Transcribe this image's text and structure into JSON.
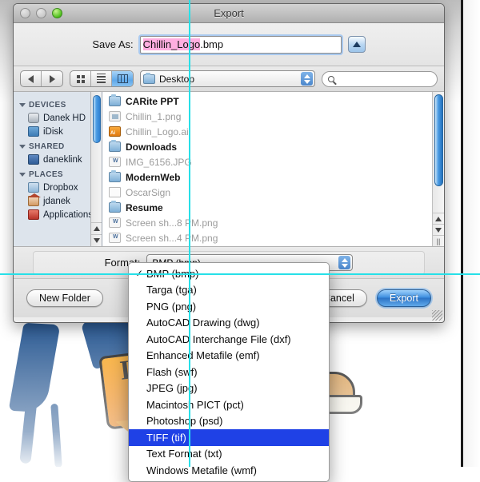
{
  "window": {
    "title": "Export",
    "traffic_lights": [
      "close",
      "minimize",
      "zoom"
    ]
  },
  "save_as": {
    "label": "Save As:",
    "selected_text": "Chillin_Logo",
    "remainder_text": ".bmp",
    "full_value": "Chillin_Logo.bmp",
    "disclosure_icon": "triangle-up-icon"
  },
  "navbar": {
    "back_icon": "chevron-left-icon",
    "forward_icon": "chevron-right-icon",
    "view_icon_grid": "icon-view-icon",
    "view_icon_list": "list-view-icon",
    "view_icon_column": "column-view-icon",
    "active_view": "column",
    "location": "Desktop",
    "location_icon": "folder-icon",
    "stepper_icon": "up-down-arrows-icon",
    "search_icon": "search-icon",
    "search_value": "",
    "search_placeholder": ""
  },
  "sidebar": {
    "sections": [
      {
        "header": "DEVICES",
        "items": [
          {
            "label": "Danek HD",
            "icon": "hard-drive-icon"
          },
          {
            "label": "iDisk",
            "icon": "idisk-icon"
          }
        ]
      },
      {
        "header": "SHARED",
        "items": [
          {
            "label": "daneklink",
            "icon": "display-icon"
          }
        ]
      },
      {
        "header": "PLACES",
        "items": [
          {
            "label": "Dropbox",
            "icon": "dropbox-folder-icon"
          },
          {
            "label": "jdanek",
            "icon": "home-icon"
          },
          {
            "label": "Applications",
            "icon": "applications-icon"
          }
        ]
      }
    ]
  },
  "filelist": {
    "items": [
      {
        "name": "CARite PPT",
        "icon": "folder-icon",
        "enabled": true,
        "has_arrow": true
      },
      {
        "name": "Chillin_1.png",
        "icon": "png-file-icon",
        "enabled": false,
        "has_arrow": false
      },
      {
        "name": "Chillin_Logo.ai",
        "icon": "ai-file-icon",
        "enabled": false,
        "has_arrow": false
      },
      {
        "name": "Downloads",
        "icon": "folder-icon",
        "enabled": true,
        "has_arrow": true
      },
      {
        "name": "IMG_6156.JPG",
        "icon": "word-file-icon",
        "enabled": false,
        "has_arrow": false
      },
      {
        "name": "ModernWeb",
        "icon": "folder-icon",
        "enabled": true,
        "has_arrow": true
      },
      {
        "name": "OscarSign",
        "icon": "doc-file-icon",
        "enabled": false,
        "has_arrow": false
      },
      {
        "name": "Resume",
        "icon": "folder-icon",
        "enabled": true,
        "has_arrow": true
      },
      {
        "name": "Screen sh...8 PM.png",
        "icon": "word-file-icon",
        "enabled": false,
        "has_arrow": false
      },
      {
        "name": "Screen sh...4 PM.png",
        "icon": "word-file-icon",
        "enabled": false,
        "has_arrow": false
      }
    ]
  },
  "format": {
    "label": "Format:",
    "selected": "BMP (bmp)",
    "options": [
      {
        "label": "BMP (bmp)",
        "checked": true,
        "highlighted": false
      },
      {
        "label": "Targa (tga)",
        "checked": false,
        "highlighted": false
      },
      {
        "label": "PNG (png)",
        "checked": false,
        "highlighted": false
      },
      {
        "label": "AutoCAD Drawing (dwg)",
        "checked": false,
        "highlighted": false
      },
      {
        "label": "AutoCAD Interchange File (dxf)",
        "checked": false,
        "highlighted": false
      },
      {
        "label": "Enhanced Metafile (emf)",
        "checked": false,
        "highlighted": false
      },
      {
        "label": "Flash (swf)",
        "checked": false,
        "highlighted": false
      },
      {
        "label": "JPEG (jpg)",
        "checked": false,
        "highlighted": false
      },
      {
        "label": "Macintosh PICT (pct)",
        "checked": false,
        "highlighted": false
      },
      {
        "label": "Photoshop (psd)",
        "checked": false,
        "highlighted": false
      },
      {
        "label": "TIFF (tif)",
        "checked": false,
        "highlighted": true
      },
      {
        "label": "Text Format (txt)",
        "checked": false,
        "highlighted": false
      },
      {
        "label": "Windows Metafile (wmf)",
        "checked": false,
        "highlighted": false
      }
    ],
    "check_glyph": "✓",
    "highlight_color": "#1f41e6"
  },
  "buttons": {
    "new_folder": "New Folder",
    "cancel": "Cancel",
    "export": "Export"
  },
  "background_art": {
    "banner_text": "Ice",
    "description": "orange banner illustration"
  }
}
